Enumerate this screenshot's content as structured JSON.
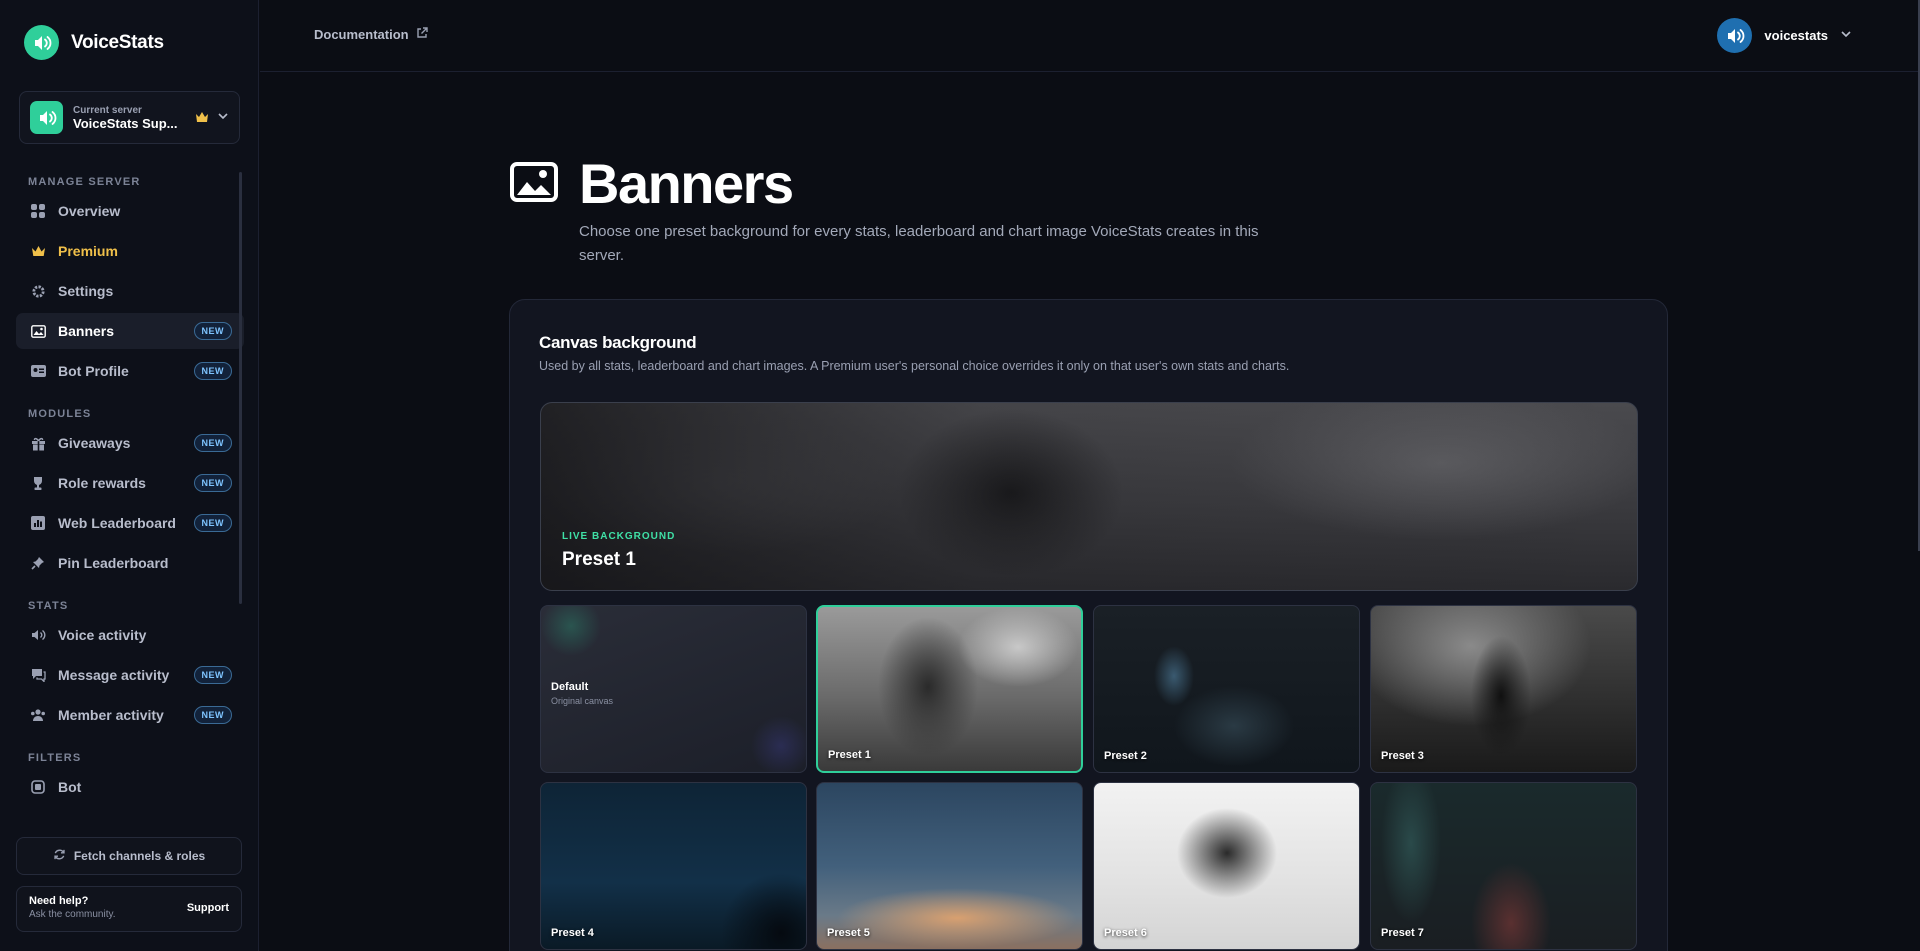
{
  "brand": {
    "name": "VoiceStats"
  },
  "server": {
    "caption": "Current server",
    "name": "VoiceStats Sup..."
  },
  "nav": {
    "manage_label": "MANAGE SERVER",
    "manage": [
      {
        "label": "Overview",
        "icon": "grid-icon"
      },
      {
        "label": "Premium",
        "icon": "crown-icon"
      },
      {
        "label": "Settings",
        "icon": "gear-icon"
      },
      {
        "label": "Banners",
        "icon": "image-icon",
        "badge": "NEW"
      },
      {
        "label": "Bot Profile",
        "icon": "id-card-icon",
        "badge": "NEW"
      }
    ],
    "modules_label": "MODULES",
    "modules": [
      {
        "label": "Giveaways",
        "icon": "gift-icon",
        "badge": "NEW"
      },
      {
        "label": "Role rewards",
        "icon": "trophy-icon",
        "badge": "NEW"
      },
      {
        "label": "Web Leaderboard",
        "icon": "chart-icon",
        "badge": "NEW"
      },
      {
        "label": "Pin Leaderboard",
        "icon": "pin-icon"
      }
    ],
    "stats_label": "STATS",
    "stats": [
      {
        "label": "Voice activity",
        "icon": "mic-icon"
      },
      {
        "label": "Message activity",
        "icon": "chat-icon",
        "badge": "NEW"
      },
      {
        "label": "Member activity",
        "icon": "users-icon",
        "badge": "NEW"
      }
    ],
    "filters_label": "FILTERS",
    "filters": [
      {
        "label": "Bot",
        "icon": "bot-icon"
      }
    ]
  },
  "fetch_button": "Fetch channels & roles",
  "help": {
    "title": "Need help?",
    "subtitle": "Ask the community.",
    "link": "Support"
  },
  "topbar": {
    "doc_link": "Documentation",
    "username": "voicestats"
  },
  "page": {
    "title": "Banners",
    "description": "Choose one preset background for every stats, leaderboard and chart image VoiceStats creates in this server."
  },
  "panel": {
    "title": "Canvas background",
    "description": "Used by all stats, leaderboard and chart images. A Premium user's personal choice overrides it only on that user's own stats and charts.",
    "live_label": "LIVE BACKGROUND",
    "live_name": "Preset 1"
  },
  "tiles": [
    {
      "label": "Default",
      "sub": "Original canvas"
    },
    {
      "label": "Preset 1",
      "selected": true
    },
    {
      "label": "Preset 2"
    },
    {
      "label": "Preset 3"
    },
    {
      "label": "Preset 4"
    },
    {
      "label": "Preset 5"
    },
    {
      "label": "Preset 6"
    },
    {
      "label": "Preset 7"
    }
  ],
  "colors": {
    "accent": "#2fcf9a",
    "premium": "#f0c04a",
    "badge": "#7fc4ff",
    "background": "#0b0d14"
  }
}
